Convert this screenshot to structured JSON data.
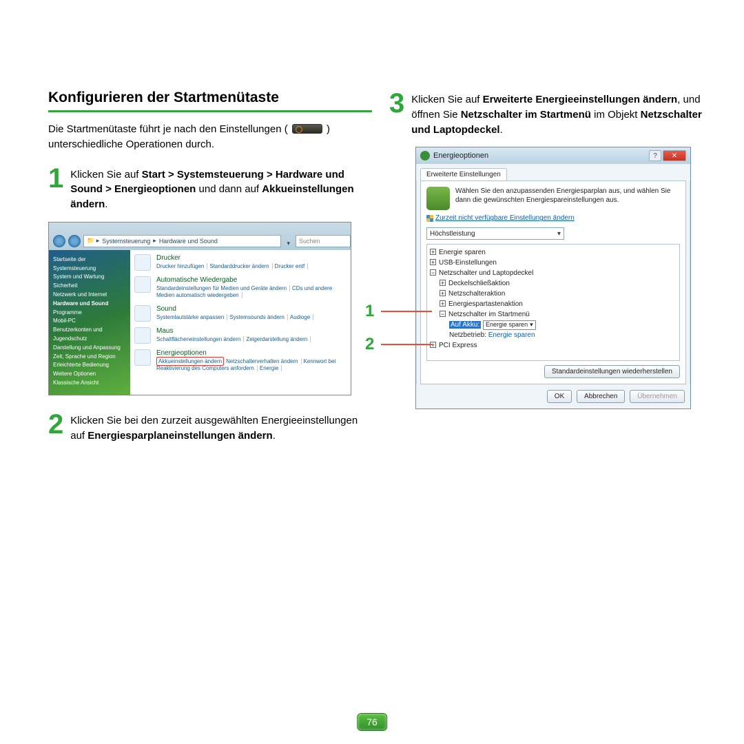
{
  "title": "Konfigurieren der Startmenütaste",
  "intro_before": "Die Startmenütaste führt je nach den Einstellungen (",
  "intro_after": ") unterschiedliche Operationen durch.",
  "steps": {
    "s1": {
      "num": "1",
      "pre": "Klicken Sie auf ",
      "bold1": "Start > Systemsteuerung > Hardware und Sound > Energieoptionen",
      "mid": " und dann auf ",
      "bold2": "Akkueinstellungen ändern",
      "post": "."
    },
    "s2": {
      "num": "2",
      "pre": "Klicken Sie bei den zurzeit ausgewählten Energieeinstellungen auf ",
      "bold": "Energiesparplaneinstellungen ändern",
      "post": "."
    },
    "s3": {
      "num": "3",
      "pre": "Klicken Sie auf ",
      "bold1": "Erweiterte Energieeinstellungen ändern",
      "mid1": ", und öffnen Sie ",
      "bold2": "Netzschalter im Startmenü",
      "mid2": " im Objekt ",
      "bold3": "Netzschalter und Laptopdeckel",
      "post": "."
    }
  },
  "callout1": "1",
  "callout2": "2",
  "shot1": {
    "breadcrumb1": "Systemsteuerung",
    "breadcrumb2": "Hardware und Sound",
    "search_placeholder": "Suchen",
    "sidebar_items": [
      "Startseite der Systemsteuerung",
      "System und Wartung",
      "Sicherheit",
      "Netzwerk und Internet",
      "Hardware und Sound",
      "Programme",
      "Mobil-PC",
      "Benutzerkonten und Jugendschutz",
      "Darstellung und Anpassung",
      "Zeit, Sprache und Region",
      "Erleichterte Bedienung",
      "Weitere Optionen",
      "",
      "Klassische Ansicht"
    ],
    "cats": [
      {
        "title": "Drucker",
        "links": [
          "Drucker hinzufügen",
          "Standarddrucker ändern",
          "Drucker entf"
        ]
      },
      {
        "title": "Automatische Wiedergabe",
        "links": [
          "Standardeinstellungen für Medien und Geräte ändern",
          "CDs und andere Medien automatisch wiedergeben"
        ]
      },
      {
        "title": "Sound",
        "links": [
          "Systemlautstärke anpassen",
          "Systemsounds ändern",
          "Audioge"
        ]
      },
      {
        "title": "Maus",
        "links": [
          "Schaltflächeneinstellungen ändern",
          "Zeigerdarstellung ändern"
        ]
      },
      {
        "title": "Energieoptionen",
        "highlight": "Akkueinstellungen ändern",
        "links": [
          "Netzschalterverhalten ändern",
          "Kennwort bei Reaktivierung des Computers anfordern",
          "Energie"
        ]
      }
    ]
  },
  "shot2": {
    "title": "Energieoptionen",
    "help_glyph": "?",
    "close_glyph": "✕",
    "tab": "Erweiterte Einstellungen",
    "desc": "Wählen Sie den anzupassenden Energiesparplan aus, und wählen Sie dann die gewünschten Energiespareinstellungen aus.",
    "shield_link": "Zurzeit nicht verfügbare Einstellungen ändern",
    "combo": "Höchstleistung",
    "tree": {
      "r1": "Energie sparen",
      "r2": "USB-Einstellungen",
      "r3": "Netzschalter und Laptopdeckel",
      "r4": "Deckelschließaktion",
      "r5": "Netzschalteraktion",
      "r6": "Energiespartastenaktion",
      "r7": "Netzschalter im Startmenü",
      "r8_label": "Auf Akku:",
      "r8_value": "Energie sparen",
      "r9_label": "Netzbetrieb:",
      "r9_value": "Energie sparen",
      "r10": "PCI Express"
    },
    "restore": "Standardeinstellungen wiederherstellen",
    "ok": "OK",
    "cancel": "Abbrechen",
    "apply": "Übernehmen"
  },
  "page_number": "76"
}
